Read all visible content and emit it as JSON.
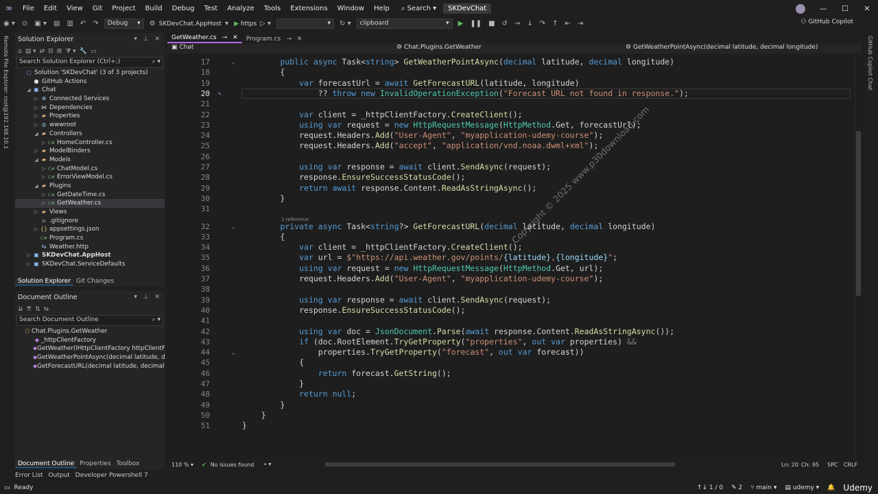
{
  "menu": [
    "File",
    "Edit",
    "View",
    "Git",
    "Project",
    "Build",
    "Debug",
    "Test",
    "Analyze",
    "Tools",
    "Extensions",
    "Window",
    "Help"
  ],
  "search_label": "Search",
  "solution_name": "SKDevChat",
  "toolbar": {
    "config": "Debug",
    "startup_project": "SKDevChat.AppHost",
    "launch_profile": "https",
    "clipboard": "clipboard",
    "copilot": "GitHub Copilot"
  },
  "left_strip": {
    "label": "Remote File Explorer: root@192.168.10.1"
  },
  "right_strip": {
    "label": "GitHub Copilot Chat"
  },
  "solution_explorer": {
    "title": "Solution Explorer",
    "search_placeholder": "Search Solution Explorer (Ctrl+;)",
    "items": [
      {
        "label": "Solution 'SKDevChat' (3 of 3 projects)",
        "depth": 0,
        "arrow": "",
        "icon": "sln"
      },
      {
        "label": "GitHub Actions",
        "depth": 1,
        "arrow": "",
        "icon": "gh"
      },
      {
        "label": "Chat",
        "depth": 1,
        "arrow": "open",
        "icon": "proj"
      },
      {
        "label": "Connected Services",
        "depth": 2,
        "arrow": "closed",
        "icon": "svc"
      },
      {
        "label": "Dependencies",
        "depth": 2,
        "arrow": "closed",
        "icon": "dep"
      },
      {
        "label": "Properties",
        "depth": 2,
        "arrow": "closed",
        "icon": "folder"
      },
      {
        "label": "wwwroot",
        "depth": 2,
        "arrow": "closed",
        "icon": "web"
      },
      {
        "label": "Controllers",
        "depth": 2,
        "arrow": "open",
        "icon": "folder"
      },
      {
        "label": "HomeController.cs",
        "depth": 3,
        "arrow": "closed",
        "icon": "cs"
      },
      {
        "label": "ModelBinders",
        "depth": 2,
        "arrow": "closed",
        "icon": "folder"
      },
      {
        "label": "Models",
        "depth": 2,
        "arrow": "open",
        "icon": "folder"
      },
      {
        "label": "ChatModel.cs",
        "depth": 3,
        "arrow": "closed",
        "icon": "cs"
      },
      {
        "label": "ErrorViewModel.cs",
        "depth": 3,
        "arrow": "closed",
        "icon": "cs"
      },
      {
        "label": "Plugins",
        "depth": 2,
        "arrow": "open",
        "icon": "folder"
      },
      {
        "label": "GetDateTime.cs",
        "depth": 3,
        "arrow": "closed",
        "icon": "cs"
      },
      {
        "label": "GetWeather.cs",
        "depth": 3,
        "arrow": "closed",
        "icon": "cs",
        "selected": true
      },
      {
        "label": "Views",
        "depth": 2,
        "arrow": "closed",
        "icon": "folder"
      },
      {
        "label": ".gitignore",
        "depth": 2,
        "arrow": "",
        "icon": "file"
      },
      {
        "label": "appsettings.json",
        "depth": 2,
        "arrow": "closed",
        "icon": "json"
      },
      {
        "label": "Program.cs",
        "depth": 2,
        "arrow": "",
        "icon": "cs"
      },
      {
        "label": "Weather.http",
        "depth": 2,
        "arrow": "",
        "icon": "http"
      },
      {
        "label": "SKDevChat.AppHost",
        "depth": 1,
        "arrow": "closed",
        "icon": "proj",
        "bold": true
      },
      {
        "label": "SKDevChat.ServiceDefaults",
        "depth": 1,
        "arrow": "closed",
        "icon": "proj"
      }
    ],
    "tabs": [
      "Solution Explorer",
      "Git Changes"
    ]
  },
  "document_outline": {
    "title": "Document Outline",
    "search_placeholder": "Search Document Outline",
    "items": [
      {
        "label": "Chat.Plugins.GetWeather",
        "depth": 0
      },
      {
        "label": "_httpClientFactory",
        "depth": 1
      },
      {
        "label": "GetWeather(IHttpClientFactory httpClientFact",
        "depth": 1
      },
      {
        "label": "GetWeatherPointAsync(decimal latitude, deci",
        "depth": 1
      },
      {
        "label": "GetForecastURL(decimal latitude, decimal lor",
        "depth": 1
      }
    ],
    "tabs": [
      "Document Outline",
      "Properties",
      "Toolbox"
    ]
  },
  "editor": {
    "tabs": [
      {
        "label": "GetWeather.cs",
        "active": true
      },
      {
        "label": "Program.cs",
        "active": false
      }
    ],
    "nav": {
      "project": "Chat",
      "type": "Chat.Plugins.GetWeather",
      "member": "GetWeatherPointAsync(decimal latitude, decimal longitude)"
    },
    "current_line": 20,
    "codelens": "1 reference",
    "watermark": "Copyright © 2025 www.p30download.com",
    "lines": [
      {
        "n": 17,
        "tokens": [
          [
            "        ",
            ""
          ],
          [
            "public",
            "k"
          ],
          [
            " ",
            ""
          ],
          [
            "async",
            "k"
          ],
          [
            " Task<",
            ""
          ],
          [
            "string",
            "k"
          ],
          [
            "> ",
            ""
          ],
          [
            "GetWeatherPointAsync",
            "m"
          ],
          [
            "(",
            ""
          ],
          [
            "decimal",
            "k"
          ],
          [
            " latitude, ",
            ""
          ],
          [
            "decimal",
            "k"
          ],
          [
            " longitude)",
            ""
          ]
        ]
      },
      {
        "n": 18,
        "tokens": [
          [
            "        {",
            ""
          ]
        ]
      },
      {
        "n": 19,
        "tokens": [
          [
            "            ",
            ""
          ],
          [
            "var",
            "k"
          ],
          [
            " forecastUrl = ",
            ""
          ],
          [
            "await",
            "k"
          ],
          [
            " ",
            ""
          ],
          [
            "GetForecastURL",
            "m"
          ],
          [
            "(latitude, longitude)",
            ""
          ]
        ]
      },
      {
        "n": 20,
        "tokens": [
          [
            "                ?? ",
            ""
          ],
          [
            "throw",
            "k"
          ],
          [
            " ",
            ""
          ],
          [
            "new",
            "k"
          ],
          [
            " ",
            ""
          ],
          [
            "InvalidOperationException",
            "t"
          ],
          [
            "(",
            ""
          ],
          [
            "\"Forecast URL not found in response.\"",
            "s"
          ],
          [
            ");",
            ""
          ]
        ]
      },
      {
        "n": 21,
        "tokens": []
      },
      {
        "n": 22,
        "tokens": [
          [
            "            ",
            ""
          ],
          [
            "var",
            "k"
          ],
          [
            " client = _httpClientFactory.",
            ""
          ],
          [
            "CreateClient",
            "m"
          ],
          [
            "();",
            ""
          ]
        ]
      },
      {
        "n": 23,
        "tokens": [
          [
            "            ",
            ""
          ],
          [
            "using",
            "k"
          ],
          [
            " ",
            ""
          ],
          [
            "var",
            "k"
          ],
          [
            " request = ",
            ""
          ],
          [
            "new",
            "k"
          ],
          [
            " ",
            ""
          ],
          [
            "HttpRequestMessage",
            "t"
          ],
          [
            "(",
            ""
          ],
          [
            "HttpMethod",
            "t"
          ],
          [
            ".Get, forecastUrl);",
            ""
          ]
        ]
      },
      {
        "n": 24,
        "tokens": [
          [
            "            request.Headers.",
            ""
          ],
          [
            "Add",
            "m"
          ],
          [
            "(",
            ""
          ],
          [
            "\"User-Agent\"",
            "s"
          ],
          [
            ", ",
            ""
          ],
          [
            "\"myapplication-udemy-course\"",
            "s"
          ],
          [
            ");",
            ""
          ]
        ]
      },
      {
        "n": 25,
        "tokens": [
          [
            "            request.Headers.",
            ""
          ],
          [
            "Add",
            "m"
          ],
          [
            "(",
            ""
          ],
          [
            "\"accept\"",
            "s"
          ],
          [
            ", ",
            ""
          ],
          [
            "\"application/vnd.noaa.dwml+xml\"",
            "s"
          ],
          [
            ");",
            ""
          ]
        ]
      },
      {
        "n": 26,
        "tokens": []
      },
      {
        "n": 27,
        "tokens": [
          [
            "            ",
            ""
          ],
          [
            "using",
            "k"
          ],
          [
            " ",
            ""
          ],
          [
            "var",
            "k"
          ],
          [
            " response = ",
            ""
          ],
          [
            "await",
            "k"
          ],
          [
            " client.",
            ""
          ],
          [
            "SendAsync",
            "m"
          ],
          [
            "(request);",
            ""
          ]
        ]
      },
      {
        "n": 28,
        "tokens": [
          [
            "            response.",
            ""
          ],
          [
            "EnsureSuccessStatusCode",
            "m"
          ],
          [
            "();",
            ""
          ]
        ]
      },
      {
        "n": 29,
        "tokens": [
          [
            "            ",
            ""
          ],
          [
            "return",
            "k"
          ],
          [
            " ",
            ""
          ],
          [
            "await",
            "k"
          ],
          [
            " response.Content.",
            ""
          ],
          [
            "ReadAsStringAsync",
            "m"
          ],
          [
            "();",
            ""
          ]
        ]
      },
      {
        "n": 30,
        "tokens": [
          [
            "        }",
            ""
          ]
        ]
      },
      {
        "n": 31,
        "tokens": []
      },
      {
        "n": 32,
        "tokens": [
          [
            "        ",
            ""
          ],
          [
            "private",
            "k"
          ],
          [
            " ",
            ""
          ],
          [
            "async",
            "k"
          ],
          [
            " Task<",
            ""
          ],
          [
            "string",
            "k"
          ],
          [
            "?> ",
            ""
          ],
          [
            "GetForecastURL",
            "m"
          ],
          [
            "(",
            ""
          ],
          [
            "decimal",
            "k"
          ],
          [
            " latitude, ",
            ""
          ],
          [
            "decimal",
            "k"
          ],
          [
            " longitude)",
            ""
          ]
        ]
      },
      {
        "n": 33,
        "tokens": [
          [
            "        {",
            ""
          ]
        ]
      },
      {
        "n": 34,
        "tokens": [
          [
            "            ",
            ""
          ],
          [
            "var",
            "k"
          ],
          [
            " client = _httpClientFactory.",
            ""
          ],
          [
            "CreateClient",
            "m"
          ],
          [
            "();",
            ""
          ]
        ]
      },
      {
        "n": 35,
        "tokens": [
          [
            "            ",
            ""
          ],
          [
            "var",
            "k"
          ],
          [
            " url = ",
            ""
          ],
          [
            "$\"https://api.weather.gov/points/",
            "s"
          ],
          [
            "{latitude}",
            "p"
          ],
          [
            ",",
            "s"
          ],
          [
            "{longitude}",
            "p"
          ],
          [
            "\"",
            "s"
          ],
          [
            ";",
            ""
          ]
        ]
      },
      {
        "n": 36,
        "tokens": [
          [
            "            ",
            ""
          ],
          [
            "using",
            "k"
          ],
          [
            " ",
            ""
          ],
          [
            "var",
            "k"
          ],
          [
            " request = ",
            ""
          ],
          [
            "new",
            "k"
          ],
          [
            " ",
            ""
          ],
          [
            "HttpRequestMessage",
            "t"
          ],
          [
            "(",
            ""
          ],
          [
            "HttpMethod",
            "t"
          ],
          [
            ".Get, url);",
            ""
          ]
        ]
      },
      {
        "n": 37,
        "tokens": [
          [
            "            request.Headers.",
            ""
          ],
          [
            "Add",
            "m"
          ],
          [
            "(",
            ""
          ],
          [
            "\"User-Agent\"",
            "s"
          ],
          [
            ", ",
            ""
          ],
          [
            "\"myapplication-udemy-course\"",
            "s"
          ],
          [
            ");",
            ""
          ]
        ]
      },
      {
        "n": 38,
        "tokens": []
      },
      {
        "n": 39,
        "tokens": [
          [
            "            ",
            ""
          ],
          [
            "using",
            "k"
          ],
          [
            " ",
            ""
          ],
          [
            "var",
            "k"
          ],
          [
            " response = ",
            ""
          ],
          [
            "await",
            "k"
          ],
          [
            " client.",
            ""
          ],
          [
            "SendAsync",
            "m"
          ],
          [
            "(request);",
            ""
          ]
        ]
      },
      {
        "n": 40,
        "tokens": [
          [
            "            response.",
            ""
          ],
          [
            "EnsureSuccessStatusCode",
            "m"
          ],
          [
            "();",
            ""
          ]
        ]
      },
      {
        "n": 41,
        "tokens": []
      },
      {
        "n": 42,
        "tokens": [
          [
            "            ",
            ""
          ],
          [
            "using",
            "k"
          ],
          [
            " ",
            ""
          ],
          [
            "var",
            "k"
          ],
          [
            " doc = ",
            ""
          ],
          [
            "JsonDocument",
            "t"
          ],
          [
            ".",
            ""
          ],
          [
            "Parse",
            "m"
          ],
          [
            "(",
            ""
          ],
          [
            "await",
            "k"
          ],
          [
            " response.Content.",
            ""
          ],
          [
            "ReadAsStringAsync",
            "m"
          ],
          [
            "());",
            ""
          ]
        ]
      },
      {
        "n": 43,
        "tokens": [
          [
            "            ",
            ""
          ],
          [
            "if",
            "k"
          ],
          [
            " (doc.RootElement.",
            ""
          ],
          [
            "TryGetProperty",
            "m"
          ],
          [
            "(",
            ""
          ],
          [
            "\"properties\"",
            "s"
          ],
          [
            ", ",
            ""
          ],
          [
            "out",
            "k"
          ],
          [
            " ",
            ""
          ],
          [
            "var",
            "k"
          ],
          [
            " properties) ",
            ""
          ],
          [
            "&&",
            "c"
          ]
        ]
      },
      {
        "n": 44,
        "tokens": [
          [
            "                properties.",
            ""
          ],
          [
            "TryGetProperty",
            "m"
          ],
          [
            "(",
            ""
          ],
          [
            "\"forecast\"",
            "s"
          ],
          [
            ", ",
            ""
          ],
          [
            "out",
            "k"
          ],
          [
            " ",
            ""
          ],
          [
            "var",
            "k"
          ],
          [
            " forecast))",
            ""
          ]
        ]
      },
      {
        "n": 45,
        "tokens": [
          [
            "            {",
            ""
          ]
        ]
      },
      {
        "n": 46,
        "tokens": [
          [
            "                ",
            ""
          ],
          [
            "return",
            "k"
          ],
          [
            " forecast.",
            ""
          ],
          [
            "GetString",
            "m"
          ],
          [
            "();",
            ""
          ]
        ]
      },
      {
        "n": 47,
        "tokens": [
          [
            "            }",
            ""
          ]
        ]
      },
      {
        "n": 48,
        "tokens": [
          [
            "            ",
            ""
          ],
          [
            "return",
            "k"
          ],
          [
            " ",
            ""
          ],
          [
            "null",
            "k"
          ],
          [
            ";",
            ""
          ]
        ]
      },
      {
        "n": 49,
        "tokens": [
          [
            "        }",
            ""
          ]
        ]
      },
      {
        "n": 50,
        "tokens": [
          [
            "    }",
            ""
          ]
        ]
      },
      {
        "n": 51,
        "tokens": [
          [
            "}",
            ""
          ]
        ]
      }
    ],
    "zoom": "110 %",
    "issues": "No issues found",
    "position": {
      "line": "Ln: 20",
      "col": "Ch: 95",
      "spc": "SPC",
      "eol": "CRLF"
    }
  },
  "tool_tabs": [
    "Error List",
    "Output",
    "Developer Powershell 7"
  ],
  "statusbar": {
    "ready": "Ready",
    "sync": "1 / 0",
    "pending": "2",
    "branch": "main",
    "repo": "udemy",
    "brand": "Udemy"
  }
}
